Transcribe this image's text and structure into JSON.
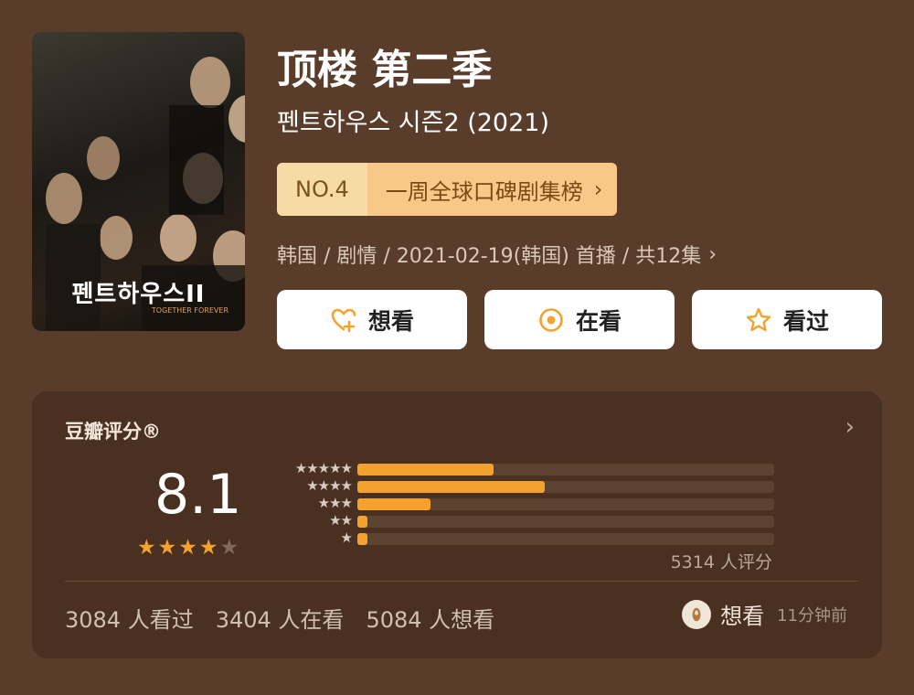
{
  "poster": {
    "title": "펜트하우스II",
    "tag": "TOGETHER FOREVER"
  },
  "show": {
    "title": "顶楼 第二季",
    "subtitle": "펜트하우스 시즌2 (2021)",
    "rank_no": "NO.4",
    "rank_name": "一周全球口碑剧集榜",
    "meta": "韩国 / 剧情 / 2021-02-19(韩国) 首播 / 共12集",
    "chevron": "›"
  },
  "buttons": {
    "want": "想看",
    "watching": "在看",
    "watched": "看过"
  },
  "rating": {
    "label": "豆瓣评分®",
    "score": "8.1",
    "stars": 4,
    "star_max": 5,
    "count_text": "5314 人评分",
    "distribution": [
      {
        "stars": "★★★★★",
        "value": 0.326
      },
      {
        "stars": "★★★★",
        "value": 0.449
      },
      {
        "stars": "★★★",
        "value": 0.175
      },
      {
        "stars": "★★",
        "value": 0.025
      },
      {
        "stars": "★",
        "value": 0.025
      }
    ]
  },
  "stats": {
    "watched": "3084 人看过",
    "watching": "3404 人在看",
    "want": "5084 人想看"
  },
  "activity": {
    "action": "想看",
    "time": "11分钟前"
  },
  "colors": {
    "accent": "#f4a12d",
    "background": "#5a3c2a",
    "card": "#4a3020"
  }
}
